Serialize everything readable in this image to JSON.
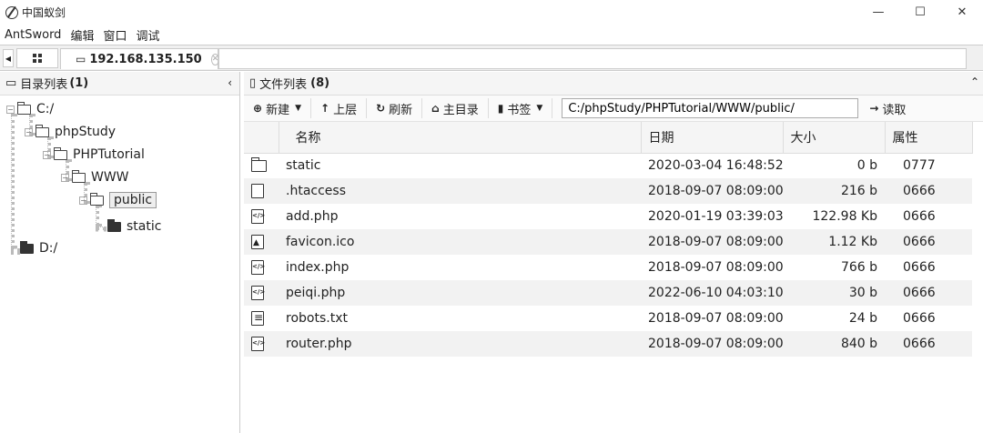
{
  "window": {
    "title": "中国蚁剑",
    "controls": {
      "minimize": "—",
      "maximize": "☐",
      "close": "✕"
    }
  },
  "menu": [
    "AntSword",
    "编辑",
    "窗口",
    "调试"
  ],
  "tabs": {
    "active_label": "192.168.135.150"
  },
  "left_pane": {
    "header_label": "目录列表",
    "header_count": "(1)",
    "collapse_icon": "‹",
    "tree": [
      {
        "label": "C:/",
        "expander": "−",
        "icon": "folder-open-icon"
      },
      {
        "label": "phpStudy",
        "expander": "−",
        "icon": "folder-open-icon"
      },
      {
        "label": "PHPTutorial",
        "expander": "−",
        "icon": "folder-open-icon"
      },
      {
        "label": "WWW",
        "expander": "−",
        "icon": "folder-open-icon"
      },
      {
        "label": "public",
        "expander": "−",
        "icon": "folder-open-icon",
        "selected": true
      },
      {
        "label": "static",
        "icon": "folder-filled-icon"
      },
      {
        "label": "D:/",
        "icon": "folder-filled-icon"
      }
    ]
  },
  "right_pane": {
    "header_label": "文件列表",
    "header_count": "(8)",
    "toolbar": {
      "new_label": "新建",
      "up_label": "上层",
      "refresh_label": "刷新",
      "home_label": "主目录",
      "bookmark_label": "书签",
      "path_value": "C:/phpStudy/PHPTutorial/WWW/public/",
      "read_label": "读取"
    },
    "columns": [
      "名称",
      "日期",
      "大小",
      "属性"
    ],
    "files": [
      {
        "name": "static",
        "date": "2020-03-04 16:48:52",
        "size": "0 b",
        "attr": "0777",
        "icon": "folder-icon"
      },
      {
        "name": ".htaccess",
        "date": "2018-09-07 08:09:00",
        "size": "216 b",
        "attr": "0666",
        "icon": "file-icon"
      },
      {
        "name": "add.php",
        "date": "2020-01-19 03:39:03",
        "size": "122.98 Kb",
        "attr": "0666",
        "icon": "code-file-icon"
      },
      {
        "name": "favicon.ico",
        "date": "2018-09-07 08:09:00",
        "size": "1.12 Kb",
        "attr": "0666",
        "icon": "image-file-icon"
      },
      {
        "name": "index.php",
        "date": "2018-09-07 08:09:00",
        "size": "766 b",
        "attr": "0666",
        "icon": "code-file-icon"
      },
      {
        "name": "peiqi.php",
        "date": "2022-06-10 04:03:10",
        "size": "30 b",
        "attr": "0666",
        "icon": "code-file-icon"
      },
      {
        "name": "robots.txt",
        "date": "2018-09-07 08:09:00",
        "size": "24 b",
        "attr": "0666",
        "icon": "text-file-icon"
      },
      {
        "name": "router.php",
        "date": "2018-09-07 08:09:00",
        "size": "840 b",
        "attr": "0666",
        "icon": "code-file-icon"
      }
    ]
  }
}
